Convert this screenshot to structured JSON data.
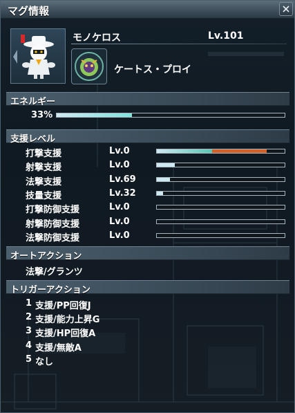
{
  "window": {
    "title": "マグ情報"
  },
  "mag": {
    "name": "モノケロス",
    "level": "Lv.101",
    "photon_blast": "ケートス・プロイ"
  },
  "energy": {
    "header": "エネルギー",
    "percent_label": "33%",
    "value": 0.33
  },
  "support": {
    "header": "支援レベル",
    "stats": [
      {
        "name": "打撃支援",
        "level": "Lv.0",
        "fill": 0.43,
        "fill2": 0.43
      },
      {
        "name": "射撃支援",
        "level": "Lv.0",
        "fill": 0.14
      },
      {
        "name": "法撃支援",
        "level": "Lv.69",
        "fill": 0.1
      },
      {
        "name": "技量支援",
        "level": "Lv.32",
        "fill": 0.05
      },
      {
        "name": "打撃防御支援",
        "level": "Lv.0",
        "fill": 0
      },
      {
        "name": "射撃防御支援",
        "level": "Lv.0",
        "fill": 0
      },
      {
        "name": "法撃防御支援",
        "level": "Lv.0",
        "fill": 0
      }
    ]
  },
  "auto_action": {
    "header": "オートアクション",
    "value": "法撃/グランツ"
  },
  "trigger_action": {
    "header": "トリガーアクション",
    "items": [
      {
        "num": "1",
        "text": "支援/PP回復J"
      },
      {
        "num": "2",
        "text": "支援/能力上昇G"
      },
      {
        "num": "3",
        "text": "支援/HP回復A"
      },
      {
        "num": "4",
        "text": "支援/無敵A"
      },
      {
        "num": "5",
        "text": "なし"
      }
    ]
  },
  "colors": {
    "energy_fill": "#7fe3dc",
    "bar_teal": "#5ac6b4",
    "bar_orange": "#d2622a",
    "bar_light": "#cfe9f2"
  }
}
